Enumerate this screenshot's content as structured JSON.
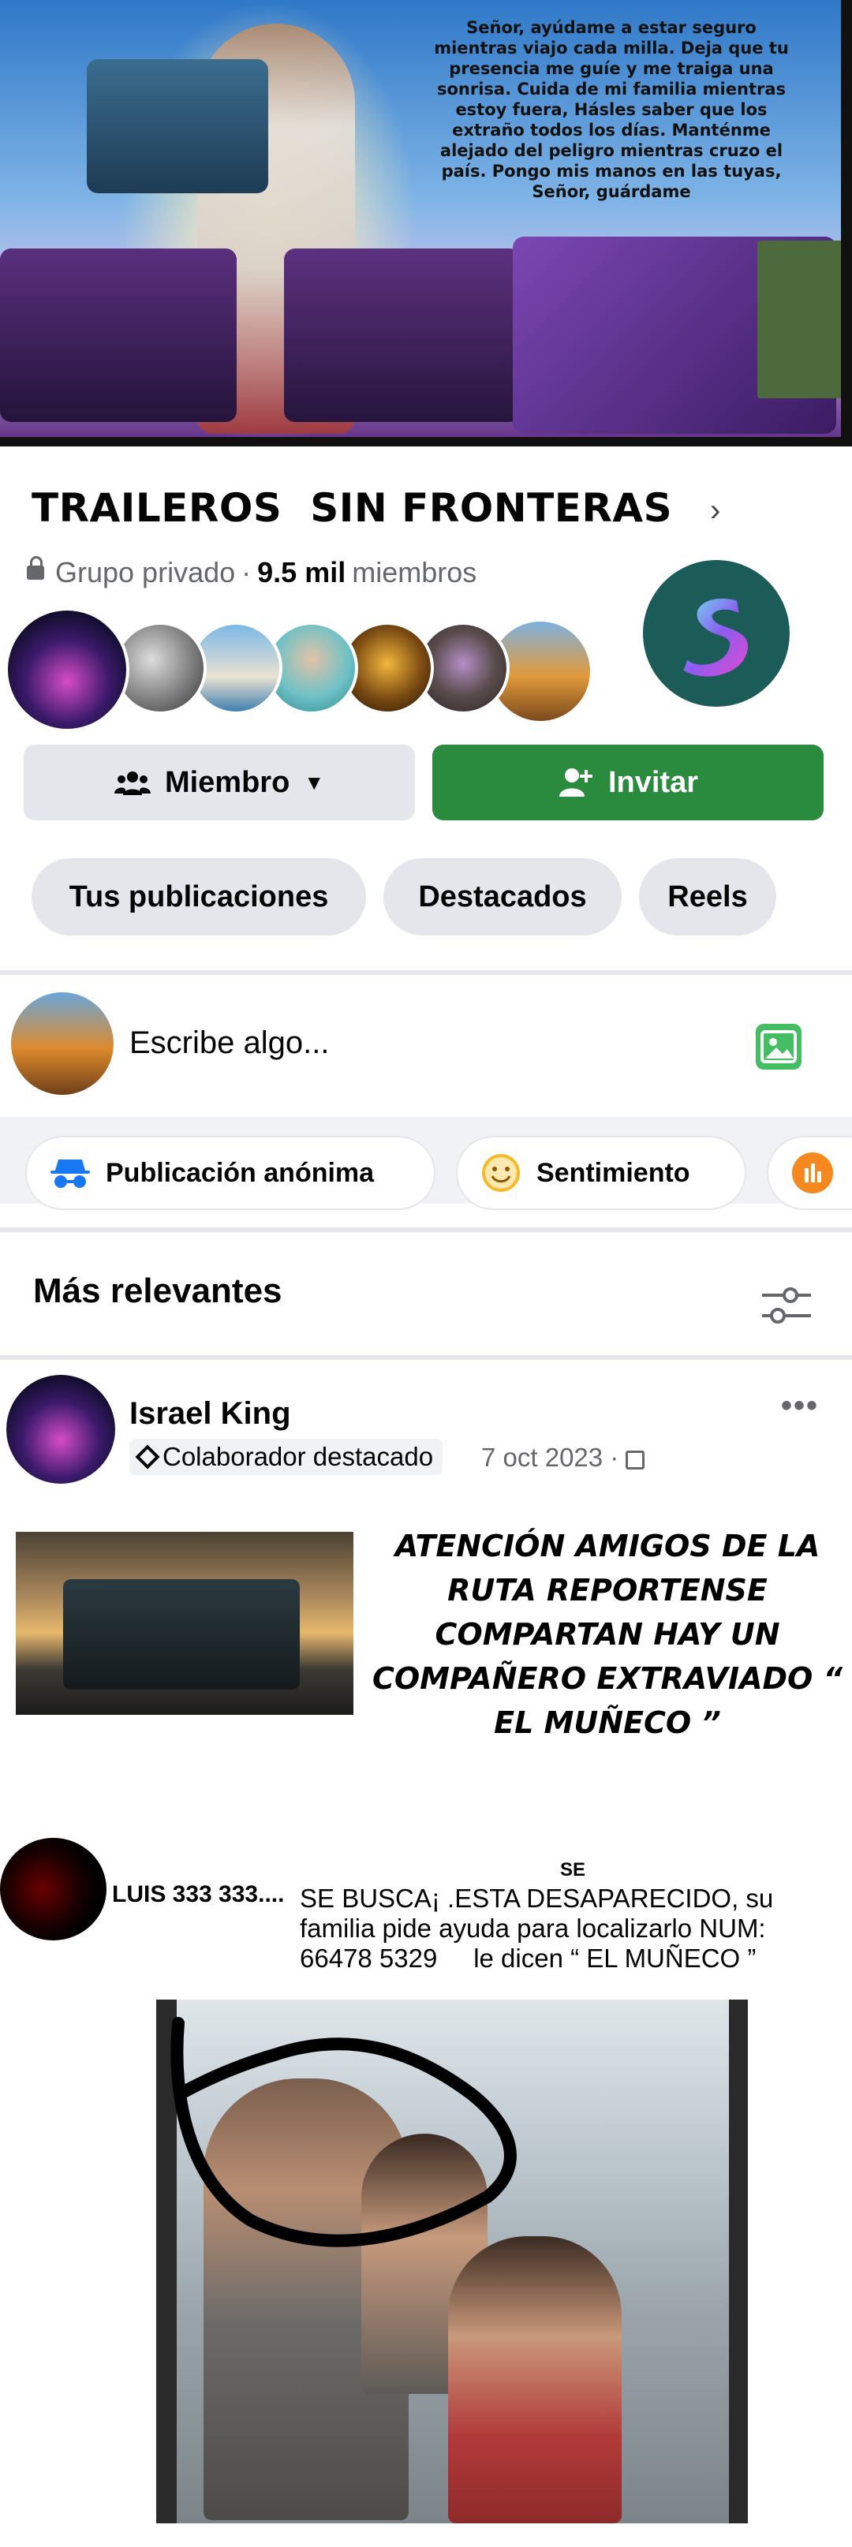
{
  "cover": {
    "prayer": "Señor, ayúdame a estar seguro mientras viajo cada milla. Deja que tu presencia me guíe y me traiga una sonrisa. Cuida de mi familia mientras estoy fuera, Hásles saber que los extraño todos los días. Manténme alejado del peligro mientras cruzo el país. Pongo mis manos en las tuyas, Señor, guárdame"
  },
  "group": {
    "name": "TRAILEROS  SIN FRONTERAS",
    "privacy": "Grupo privado",
    "separator": "·",
    "members_count": "9.5 mil",
    "members_label": "miembros"
  },
  "actions": {
    "member_label": "Miembro",
    "invite_label": "Invitar"
  },
  "tabs": [
    "Tus publicaciones",
    "Destacados",
    "Reels"
  ],
  "composer": {
    "placeholder": "Escribe algo..."
  },
  "chips": [
    "Publicación anónima",
    "Sentimiento"
  ],
  "feed": {
    "sort_label": "Más relevantes"
  },
  "post": {
    "author": "Israel King",
    "badge": "Colaborador destacado",
    "date": "7 oct 2023",
    "date_sep": "·",
    "more": "•••",
    "headline": "ATENCIÓN AMIGOS DE LA RUTA REPORTENSE COMPARTAN HAY UN COMPAÑERO EXTRAVIADO “ EL MUÑECO ”",
    "inner_se": "SE",
    "inner_name": "LUIS 333 333....",
    "inner_text": "SE BUSCA¡ .ESTA DESAPARECIDO, su familia pide ayuda para localizarlo NUM: 66478 5329     le dicen “ EL MUÑECO ”"
  },
  "colors": {
    "primary_green": "#2a8a3e",
    "chip_gray": "#e4e6eb",
    "text_gray": "#65676b"
  }
}
